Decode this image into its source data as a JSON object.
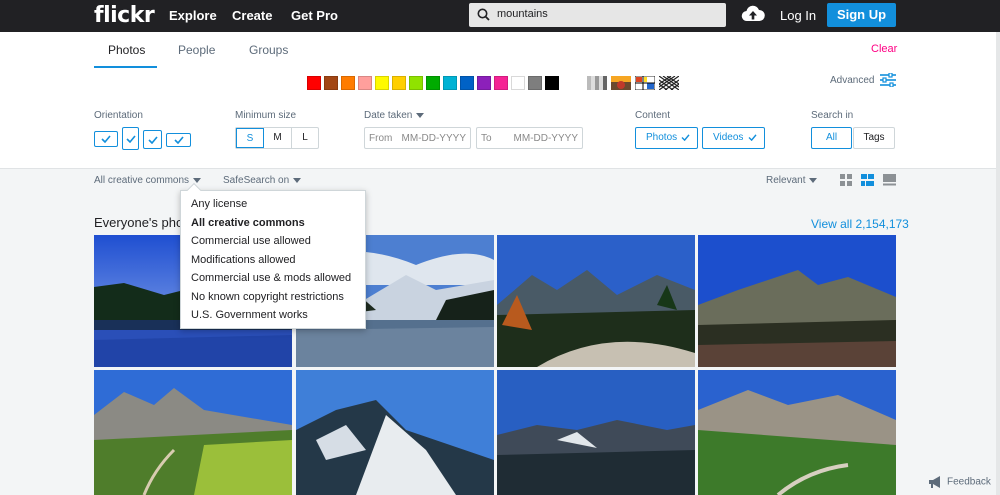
{
  "header": {
    "logo": "flickr",
    "nav": [
      "Explore",
      "Create",
      "Get Pro"
    ],
    "search_value": "mountains",
    "login": "Log In",
    "signup": "Sign Up"
  },
  "tabs": [
    "Photos",
    "People",
    "Groups"
  ],
  "clear": "Clear",
  "colors": [
    "#ff0000",
    "#a24615",
    "#ff7c00",
    "#ff9f9c",
    "#fffa00",
    "#ffcf00",
    "#90e200",
    "#00ab00",
    "#00b2d4",
    "#0062c6",
    "#8c20ba",
    "#f52394",
    "#ffffff",
    "#7e7e7e",
    "#000000"
  ],
  "advanced": "Advanced",
  "filters": {
    "orientation_label": "Orientation",
    "min_size_label": "Minimum size",
    "min_size_options": [
      "S",
      "M",
      "L"
    ],
    "min_size_selected": "S",
    "date_label": "Date taken",
    "from_label": "From",
    "from_placeholder": "MM-DD-YYYY",
    "to_label": "To",
    "to_placeholder": "MM-DD-YYYY",
    "content_label": "Content",
    "content_photos": "Photos",
    "content_videos": "Videos",
    "search_in_label": "Search in",
    "search_all": "All",
    "search_tags": "Tags"
  },
  "subbar": {
    "license": "All creative commons",
    "safesearch": "SafeSearch on",
    "sort": "Relevant"
  },
  "results": {
    "heading": "Everyone's pho",
    "view_all": "View all 2,154,173"
  },
  "license_dropdown": {
    "selected": "All creative commons",
    "options": [
      "Any license",
      "All creative commons",
      "Commercial use allowed",
      "Modifications allowed",
      "Commercial use & mods allowed",
      "No known copyright restrictions",
      "U.S. Government works"
    ]
  },
  "feedback": "Feedback"
}
